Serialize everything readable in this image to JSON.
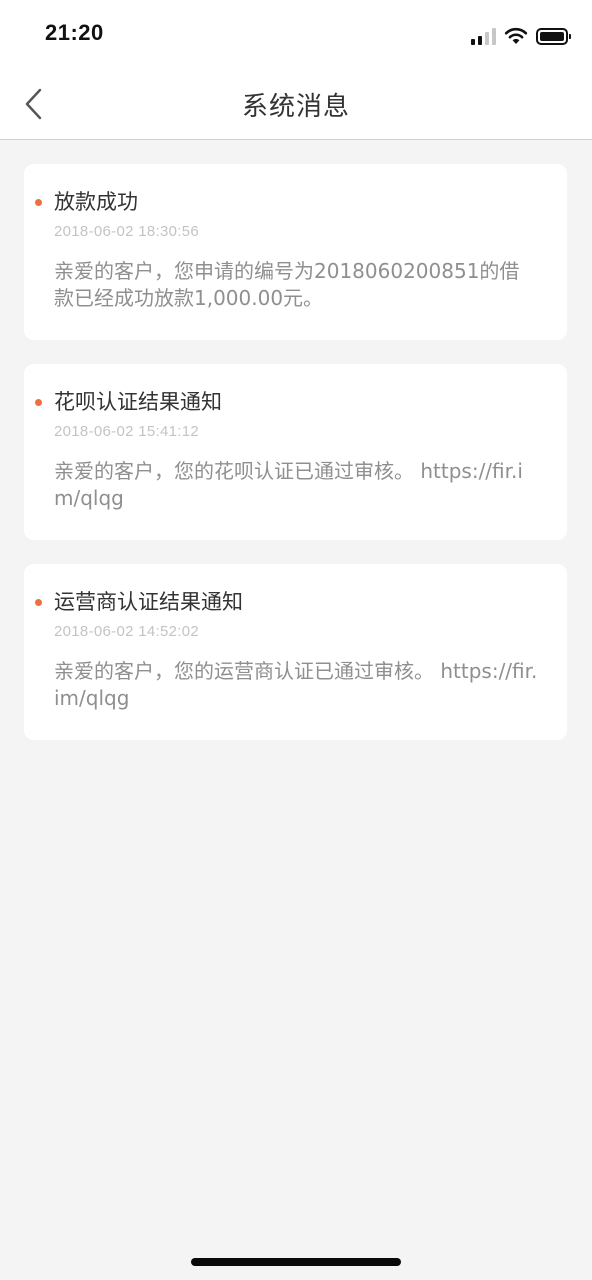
{
  "status_bar": {
    "time": "21:20",
    "signal_bars_active": 2,
    "signal_bars_total": 4,
    "battery_percent": 100
  },
  "nav": {
    "title": "系统消息",
    "back_icon": "chevron-left-icon"
  },
  "accent_color": "#ee6f44",
  "messages": [
    {
      "title": "放款成功",
      "time": "2018-06-02 18:30:56",
      "body": "亲爱的客户，您申请的编号为2018060200851的借款已经成功放款1,000.00元。"
    },
    {
      "title": "花呗认证结果通知",
      "time": "2018-06-02 15:41:12",
      "body": "亲爱的客户，您的花呗认证已通过审核。 https://fir.im/qlqg"
    },
    {
      "title": "运营商认证结果通知",
      "time": "2018-06-02 14:52:02",
      "body": "亲爱的客户，您的运营商认证已通过审核。 https://fir.im/qlqg"
    }
  ]
}
